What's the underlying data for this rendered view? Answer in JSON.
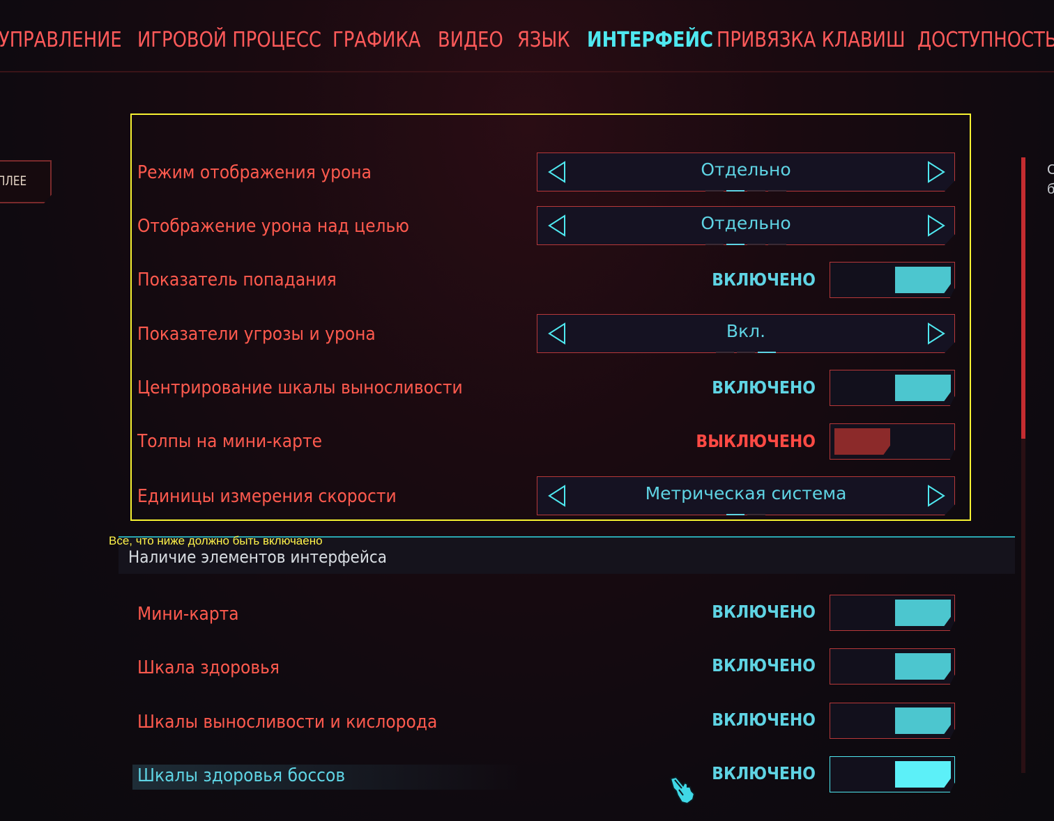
{
  "nav": {
    "tabs": [
      {
        "label": "УПРАВЛЕНИЕ",
        "active": false
      },
      {
        "label": "ИГРОВОЙ ПРОЦЕСС",
        "active": false
      },
      {
        "label": "ГРАФИКА",
        "active": false
      },
      {
        "label": "ВИДЕО",
        "active": false
      },
      {
        "label": "ЯЗЫК",
        "active": false
      },
      {
        "label": "ИНТЕРФЕЙС",
        "active": true
      },
      {
        "label": "ПРИВЯЗКА КЛАВИШ",
        "active": false
      },
      {
        "label": "ДОСТУПНОСТЬ",
        "active": false
      }
    ]
  },
  "side_button": {
    "label": "ПЛЕЕ"
  },
  "right_partial": {
    "line1": "С",
    "line2": "б"
  },
  "annotation": {
    "note": "Все, что ниже должно быть включаено"
  },
  "settings": [
    {
      "label": "Режим отображения урона",
      "type": "selector",
      "value": "Отдельно",
      "dots": 4,
      "active_dot": 1
    },
    {
      "label": "Отображение урона над целью",
      "type": "selector",
      "value": "Отдельно",
      "dots": 4,
      "active_dot": 1
    },
    {
      "label": "Показатель попадания",
      "type": "toggle",
      "state": "ВКЛЮЧЕНО",
      "on": true
    },
    {
      "label": "Показатели угрозы и урона",
      "type": "selector",
      "value": "Вкл.",
      "dots": 3,
      "active_dot": 2
    },
    {
      "label": "Центрирование шкалы выносливости",
      "type": "toggle",
      "state": "ВКЛЮЧЕНО",
      "on": true
    },
    {
      "label": "Толпы на мини-карте",
      "type": "toggle",
      "state": "ВЫКЛЮЧЕНО",
      "on": false
    },
    {
      "label": "Единицы измерения скорости",
      "type": "selector",
      "value": "Метрическая система",
      "dots": 2,
      "active_dot": 0
    }
  ],
  "section": {
    "title": "Наличие элементов интерфейса"
  },
  "settings2": [
    {
      "label": "Мини-карта",
      "state": "ВКЛЮЧЕНО",
      "on": true
    },
    {
      "label": "Шкала здоровья",
      "state": "ВКЛЮЧЕНО",
      "on": true
    },
    {
      "label": "Шкалы выносливости и кислорода",
      "state": "ВКЛЮЧЕНО",
      "on": true
    },
    {
      "label": "Шкалы здоровья боссов",
      "state": "ВКЛЮЧЕНО",
      "on": true,
      "hover": true
    }
  ],
  "colors": {
    "accent": "#4fe8f0",
    "primary": "#ff5a4e",
    "highlight": "#f7f232"
  },
  "icons": {
    "left": "arrow-left-icon",
    "right": "arrow-right-icon",
    "cursor": "hand-cursor-icon"
  }
}
